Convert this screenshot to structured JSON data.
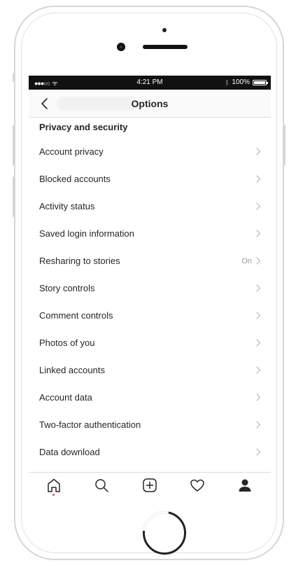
{
  "status_bar": {
    "signal": "●●●○○",
    "wifi": "ᯤ",
    "time": "4:21 PM",
    "bluetooth": "ᛒ",
    "battery": "100%"
  },
  "nav": {
    "title": "Options",
    "back_icon": "chevron-left-icon"
  },
  "section": {
    "title": "Privacy and security"
  },
  "items": [
    {
      "label": "Account privacy",
      "value": ""
    },
    {
      "label": "Blocked accounts",
      "value": ""
    },
    {
      "label": "Activity status",
      "value": ""
    },
    {
      "label": "Saved login information",
      "value": ""
    },
    {
      "label": "Resharing to stories",
      "value": "On"
    },
    {
      "label": "Story controls",
      "value": ""
    },
    {
      "label": "Comment controls",
      "value": ""
    },
    {
      "label": "Photos of you",
      "value": ""
    },
    {
      "label": "Linked accounts",
      "value": ""
    },
    {
      "label": "Account data",
      "value": ""
    },
    {
      "label": "Two-factor authentication",
      "value": ""
    },
    {
      "label": "Data download",
      "value": ""
    }
  ],
  "tab_bar": {
    "tabs": [
      "home-icon",
      "search-icon",
      "add-post-icon",
      "heart-icon",
      "profile-icon"
    ],
    "active": "profile-icon",
    "notification_dot_color": "#ed4956"
  },
  "colors": {
    "text": "#262626",
    "secondary": "#999999",
    "divider": "#dbdbdb"
  }
}
